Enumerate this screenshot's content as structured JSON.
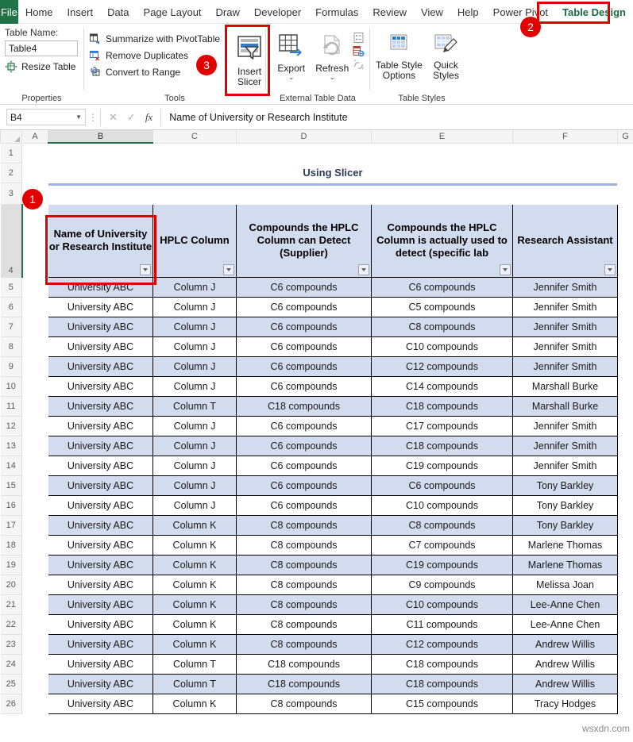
{
  "ribbon": {
    "file_tab": "File",
    "tabs": [
      {
        "label": "Home",
        "active": false
      },
      {
        "label": "Insert",
        "active": false
      },
      {
        "label": "Data",
        "active": false
      },
      {
        "label": "Page Layout",
        "active": false
      },
      {
        "label": "Draw",
        "active": false
      },
      {
        "label": "Developer",
        "active": false
      },
      {
        "label": "Formulas",
        "active": false
      },
      {
        "label": "Review",
        "active": false
      },
      {
        "label": "View",
        "active": false
      },
      {
        "label": "Help",
        "active": false
      },
      {
        "label": "Power Pivot",
        "active": false
      },
      {
        "label": "Table Design",
        "active": true
      }
    ],
    "groups": {
      "properties": {
        "label": "Properties",
        "table_name_label": "Table Name:",
        "table_name_value": "Table4",
        "resize_table": "Resize Table"
      },
      "tools": {
        "label": "Tools",
        "summarize": "Summarize with PivotTable",
        "remove_duplicates": "Remove Duplicates",
        "convert_to_range": "Convert to Range",
        "insert_slicer_line1": "Insert",
        "insert_slicer_line2": "Slicer"
      },
      "external_table_data": {
        "label": "External Table Data",
        "export": "Export",
        "refresh": "Refresh"
      },
      "table_styles": {
        "label": "Table Styles",
        "table_style_options_line1": "Table Style",
        "table_style_options_line2": "Options",
        "quick_styles_line1": "Quick",
        "quick_styles_line2": "Styles"
      }
    }
  },
  "annotations": {
    "marker_1": "1",
    "marker_2": "2",
    "marker_3": "3"
  },
  "formula_bar": {
    "name_box": "B4",
    "value": "Name of University or Research Institute"
  },
  "sheet": {
    "column_headers": [
      "A",
      "B",
      "C",
      "D",
      "E",
      "F",
      "G"
    ],
    "selected_column": "B",
    "row_numbers": [
      "1",
      "2",
      "3",
      "4",
      "5",
      "6",
      "7",
      "8",
      "9",
      "10",
      "11",
      "12",
      "13",
      "14",
      "15",
      "16",
      "17",
      "18",
      "19",
      "20",
      "21",
      "22",
      "23",
      "24",
      "25",
      "26"
    ],
    "selected_row": "4",
    "title": "Using Slicer",
    "watermark": "wsxdn.com"
  },
  "table": {
    "headers": [
      "Name of University or Research Institute",
      "HPLC Column",
      "Compounds the HPLC Column can Detect (Supplier)",
      "Compounds the HPLC Column is actually used to detect (specific lab",
      "Research Assistant"
    ],
    "rows": [
      [
        "University ABC",
        "Column J",
        "C6 compounds",
        "C6 compounds",
        "Jennifer Smith"
      ],
      [
        "University ABC",
        "Column J",
        "C6 compounds",
        "C5 compounds",
        "Jennifer Smith"
      ],
      [
        "University ABC",
        "Column J",
        "C6 compounds",
        "C8 compounds",
        "Jennifer Smith"
      ],
      [
        "University ABC",
        "Column J",
        "C6 compounds",
        "C10 compounds",
        "Jennifer Smith"
      ],
      [
        "University ABC",
        "Column J",
        "C6 compounds",
        "C12 compounds",
        "Jennifer Smith"
      ],
      [
        "University ABC",
        "Column J",
        "C6 compounds",
        "C14 compounds",
        "Marshall Burke"
      ],
      [
        "University ABC",
        "Column T",
        "C18 compounds",
        "C18 compounds",
        "Marshall Burke"
      ],
      [
        "University ABC",
        "Column J",
        "C6 compounds",
        "C17 compounds",
        "Jennifer Smith"
      ],
      [
        "University ABC",
        "Column J",
        "C6 compounds",
        "C18 compounds",
        "Jennifer Smith"
      ],
      [
        "University ABC",
        "Column J",
        "C6 compounds",
        "C19 compounds",
        "Jennifer Smith"
      ],
      [
        "University ABC",
        "Column J",
        "C6 compounds",
        "C6 compounds",
        "Tony Barkley"
      ],
      [
        "University ABC",
        "Column J",
        "C6 compounds",
        "C10 compounds",
        "Tony Barkley"
      ],
      [
        "University ABC",
        "Column K",
        "C8 compounds",
        "C8 compounds",
        "Tony Barkley"
      ],
      [
        "University ABC",
        "Column K",
        "C8 compounds",
        "C7 compounds",
        "Marlene Thomas"
      ],
      [
        "University ABC",
        "Column K",
        "C8 compounds",
        "C19 compounds",
        "Marlene Thomas"
      ],
      [
        "University ABC",
        "Column K",
        "C8 compounds",
        "C9 compounds",
        "Melissa Joan"
      ],
      [
        "University ABC",
        "Column K",
        "C8 compounds",
        "C10 compounds",
        "Lee-Anne Chen"
      ],
      [
        "University ABC",
        "Column K",
        "C8 compounds",
        "C11 compounds",
        "Lee-Anne Chen"
      ],
      [
        "University ABC",
        "Column K",
        "C8 compounds",
        "C12 compounds",
        "Andrew Willis"
      ],
      [
        "University ABC",
        "Column T",
        "C18 compounds",
        "C18 compounds",
        "Andrew Willis"
      ],
      [
        "University ABC",
        "Column T",
        "C18 compounds",
        "C18 compounds",
        "Andrew Willis"
      ],
      [
        "University ABC",
        "Column K",
        "C8 compounds",
        "C15 compounds",
        "Tracy Hodges"
      ]
    ]
  },
  "colors": {
    "excel_green": "#217346",
    "table_band": "#d3dbee",
    "title_blue": "#2c3a5a",
    "marker_red": "#e00000"
  }
}
